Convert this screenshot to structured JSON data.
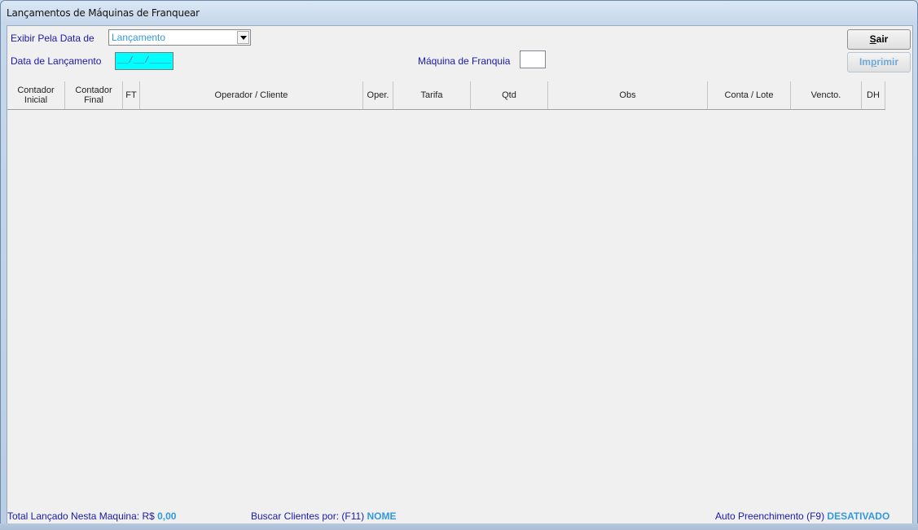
{
  "window": {
    "title": "Lançamentos de Máquinas de Franquear"
  },
  "filters": {
    "exibir_label": "Exibir Pela Data de",
    "exibir_value": "Lançamento",
    "data_label": "Data de Lançamento",
    "data_value": "__/__/____",
    "maquina_label": "Máquina de Franquia",
    "maquina_value": ""
  },
  "buttons": {
    "sair": "air",
    "sair_hotkey": "S",
    "imprimir_pre": "Im",
    "imprimir_hotkey": "p",
    "imprimir_post": "rimir"
  },
  "grid": {
    "columns": [
      {
        "line1": "Contador",
        "line2": "Inicial"
      },
      {
        "line1": "Contador",
        "line2": "Final"
      },
      {
        "line1": "FT",
        "line2": ""
      },
      {
        "line1": "Operador / Cliente",
        "line2": ""
      },
      {
        "line1": "Oper.",
        "line2": ""
      },
      {
        "line1": "Tarifa",
        "line2": ""
      },
      {
        "line1": "Qtd",
        "line2": ""
      },
      {
        "line1": "Obs",
        "line2": ""
      },
      {
        "line1": "Conta / Lote",
        "line2": ""
      },
      {
        "line1": "Vencto.",
        "line2": ""
      },
      {
        "line1": "DH",
        "line2": ""
      }
    ]
  },
  "status": {
    "total_label": "Total Lançado Nesta Maquina: R$",
    "total_value": "0,00",
    "buscar_label": "Buscar Clientes por: (F11)",
    "buscar_value": "NOME",
    "auto_label": "Auto Preenchimento (F9)",
    "auto_value": "DESATIVADO"
  },
  "colors": {
    "label": "#1a1aa8",
    "value": "#3399dd",
    "date_bg": "#00ffff"
  }
}
